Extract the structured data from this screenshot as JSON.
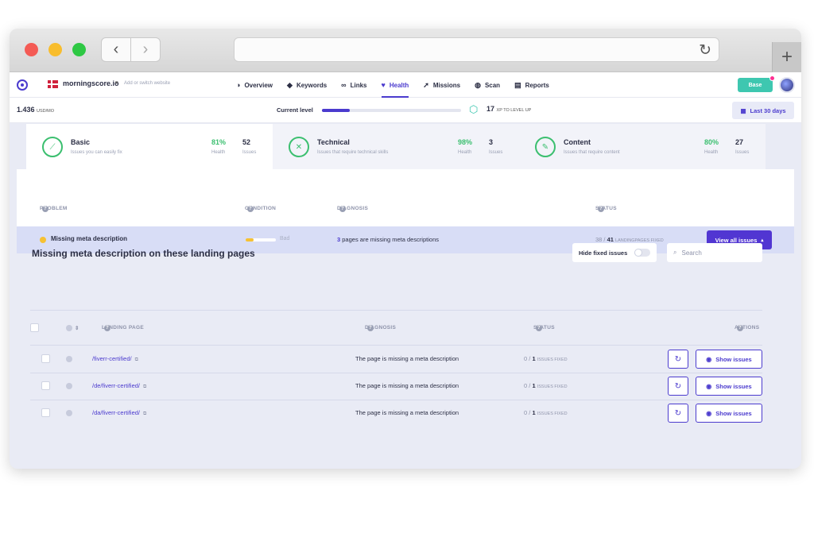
{
  "browser": {
    "back_icon": "‹",
    "forward_icon": "›",
    "reload_icon": "↻",
    "new_tab_icon": "+"
  },
  "nav": {
    "site": "morningscore.io",
    "site_caret": "▾",
    "switch_hint": "Add or switch website",
    "items": [
      {
        "label": "Overview",
        "icon": "planet-icon",
        "glyph": "◑"
      },
      {
        "label": "Keywords",
        "icon": "tag-icon",
        "glyph": "◆"
      },
      {
        "label": "Links",
        "icon": "link-icon",
        "glyph": "∞"
      },
      {
        "label": "Health",
        "icon": "heart-icon",
        "glyph": "♥",
        "active": true
      },
      {
        "label": "Missions",
        "icon": "rocket-icon",
        "glyph": "➚"
      },
      {
        "label": "Scan",
        "icon": "globe-icon",
        "glyph": "◍"
      },
      {
        "label": "Reports",
        "icon": "document-icon",
        "glyph": "▤"
      }
    ],
    "base_label": "Base",
    "accent_color": "#4b3bce",
    "teal_color": "#3ec7b0"
  },
  "stats": {
    "price": "1.436",
    "price_unit": "USD/MO",
    "current_level_label": "Current level",
    "level_progress": 0.2,
    "xp_value": "17",
    "xp_label": "XP TO LEVEL UP",
    "date_range": "Last 30 days"
  },
  "cards": [
    {
      "title": "Basic",
      "subtitle": "Issues you can easily fix",
      "health": "81%",
      "health_label": "Health",
      "issues": "52",
      "issues_label": "Issues",
      "icon": "wand-icon",
      "glyph": "⟋"
    },
    {
      "title": "Technical",
      "subtitle": "Issues that require technical skills",
      "health": "98%",
      "health_label": "Health",
      "issues": "3",
      "issues_label": "Issues",
      "icon": "tools-icon",
      "glyph": "✕"
    },
    {
      "title": "Content",
      "subtitle": "Issues that require content",
      "health": "80%",
      "health_label": "Health",
      "issues": "27",
      "issues_label": "Issues",
      "icon": "pencil-icon",
      "glyph": "✎"
    }
  ],
  "problems_table": {
    "headers": {
      "problem": "PROBLEM",
      "condition": "CONDITION",
      "diagnosis": "DIAGNOSIS",
      "status": "STATUS"
    },
    "help_glyph": "?",
    "row": {
      "problem": "Missing meta description",
      "condition": "Bad",
      "condition_level": 0.25,
      "diagnosis_count": "3",
      "diagnosis_text": "pages are missing meta descriptions",
      "status_fixed": "38",
      "status_sep": " / ",
      "status_total": "41",
      "status_unit": "LANDINGPAGES FIXED",
      "button": "View all issues",
      "button_caret": "▴"
    }
  },
  "landing": {
    "title": "Missing meta description on these landing pages",
    "hide_fixed": "Hide fixed issues",
    "search_placeholder": "Search",
    "headers": {
      "sort": "⇕",
      "page": "LANDING PAGE",
      "diagnosis": "DIAGNOSIS",
      "status": "STATUS",
      "actions": "ACTIONS"
    },
    "rows": [
      {
        "url": "/fiverr-certified/",
        "diagnosis": "The page is missing a meta description",
        "fixed": "0",
        "sep": " / ",
        "total": "1",
        "unit": "ISSUES FIXED",
        "button": "Show issues"
      },
      {
        "url": "/de/fiverr-certified/",
        "diagnosis": "The page is missing a meta description",
        "fixed": "0",
        "sep": " / ",
        "total": "1",
        "unit": "ISSUES FIXED",
        "button": "Show issues"
      },
      {
        "url": "/da/fiverr-certified/",
        "diagnosis": "The page is missing a meta description",
        "fixed": "0",
        "sep": " / ",
        "total": "1",
        "unit": "ISSUES FIXED",
        "button": "Show issues"
      }
    ],
    "external_glyph": "⧉",
    "refresh_glyph": "↻",
    "eye_glyph": "◉",
    "search_glyph": "⌕"
  }
}
